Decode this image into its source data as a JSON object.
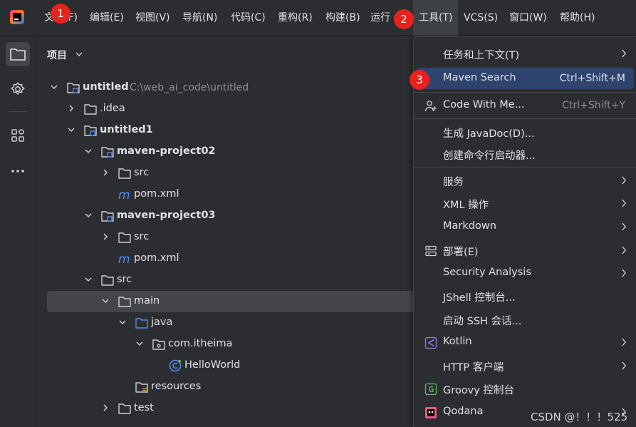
{
  "menubar": {
    "logo_icon": "intellij-logo-icon",
    "items": [
      {
        "label": "文件(F)"
      },
      {
        "label": "编辑(E)"
      },
      {
        "label": "视图(V)"
      },
      {
        "label": "导航(N)"
      },
      {
        "label": "代码(C)"
      },
      {
        "label": "重构(R)"
      },
      {
        "label": "构建(B)"
      },
      {
        "label": "运行"
      },
      {
        "label": "工具(T)"
      },
      {
        "label": "VCS(S)"
      },
      {
        "label": "窗口(W)"
      },
      {
        "label": "帮助(H)"
      }
    ],
    "active_item": "工具(T)"
  },
  "steps": [
    "1",
    "2",
    "3"
  ],
  "toolstrip": {
    "icons": [
      "folder-icon",
      "plugin-gear-icon",
      "structure-icon",
      "more-icon"
    ]
  },
  "project_panel": {
    "title": "项目",
    "tree": [
      {
        "label": "untitled",
        "path": "C:\\web_ai_code\\untitled",
        "bold": true
      },
      {
        "label": ".idea"
      },
      {
        "label": "untitled1",
        "bold": true
      },
      {
        "label": "maven-project02",
        "bold": true
      },
      {
        "label": "src"
      },
      {
        "label": "pom.xml"
      },
      {
        "label": "maven-project03",
        "bold": true
      },
      {
        "label": "src"
      },
      {
        "label": "pom.xml"
      },
      {
        "label": "src"
      },
      {
        "label": "main"
      },
      {
        "label": "java"
      },
      {
        "label": "com.itheima"
      },
      {
        "label": "HelloWorld"
      },
      {
        "label": "resources"
      },
      {
        "label": "test"
      }
    ]
  },
  "tools_menu": {
    "items": [
      {
        "label": "任务和上下文(T)",
        "shortcut": "",
        "submenu": true
      },
      {
        "label": "Maven Search",
        "shortcut": "Ctrl+Shift+M",
        "submenu": false
      },
      {
        "label": "Code With Me...",
        "shortcut": "Ctrl+Shift+Y",
        "submenu": false
      },
      {
        "label": "生成 JavaDoc(D)...",
        "shortcut": "",
        "submenu": false
      },
      {
        "label": "创建命令行启动器...",
        "shortcut": "",
        "submenu": false
      },
      {
        "label": "服务",
        "shortcut": "",
        "submenu": true
      },
      {
        "label": "XML 操作",
        "shortcut": "",
        "submenu": true
      },
      {
        "label": "Markdown",
        "shortcut": "",
        "submenu": true
      },
      {
        "label": "部署(E)",
        "shortcut": "",
        "submenu": true
      },
      {
        "label": "Security Analysis",
        "shortcut": "",
        "submenu": true
      },
      {
        "label": "JShell 控制台...",
        "shortcut": "",
        "submenu": false
      },
      {
        "label": "启动 SSH 会话...",
        "shortcut": "",
        "submenu": false
      },
      {
        "label": "Kotlin",
        "shortcut": "",
        "submenu": true
      },
      {
        "label": "HTTP 客户端",
        "shortcut": "",
        "submenu": true
      },
      {
        "label": "Groovy 控制台",
        "shortcut": "",
        "submenu": false
      },
      {
        "label": "Qodana",
        "shortcut": "",
        "submenu": true
      }
    ],
    "highlighted": "Maven Search"
  },
  "watermark": "CSDN @！！！525",
  "colors": {
    "background": "#2b2d30",
    "highlight": "#2e436e",
    "selected_row": "#43454a",
    "badge": "#e5231c",
    "text": "#dfe1e5",
    "muted": "#8c8f94",
    "folder_blue": "#548af7"
  }
}
